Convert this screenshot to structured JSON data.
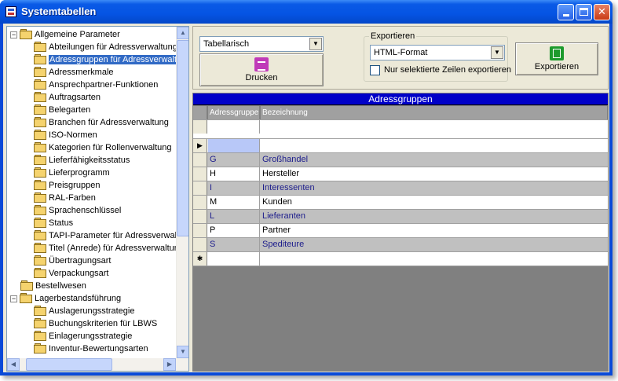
{
  "window": {
    "title": "Systemtabellen"
  },
  "tree": {
    "items": [
      {
        "label": "Allgemeine Parameter",
        "level": 0,
        "expander": "−"
      },
      {
        "label": "Abteilungen für Adressverwaltung",
        "level": 1
      },
      {
        "label": "Adressgruppen für Adressverwaltung",
        "level": 1,
        "selected": true
      },
      {
        "label": "Adressmerkmale",
        "level": 1
      },
      {
        "label": "Ansprechpartner-Funktionen",
        "level": 1
      },
      {
        "label": "Auftragsarten",
        "level": 1
      },
      {
        "label": "Belegarten",
        "level": 1
      },
      {
        "label": "Branchen für Adressverwaltung",
        "level": 1
      },
      {
        "label": "ISO-Normen",
        "level": 1
      },
      {
        "label": "Kategorien für Rollenverwaltung",
        "level": 1
      },
      {
        "label": "Lieferfähigkeitsstatus",
        "level": 1
      },
      {
        "label": "Lieferprogramm",
        "level": 1
      },
      {
        "label": "Preisgruppen",
        "level": 1
      },
      {
        "label": "RAL-Farben",
        "level": 1
      },
      {
        "label": "Sprachenschlüssel",
        "level": 1
      },
      {
        "label": "Status",
        "level": 1
      },
      {
        "label": "TAPI-Parameter für Adressverwaltung",
        "level": 1
      },
      {
        "label": "Titel (Anrede) für Adressverwaltung",
        "level": 1
      },
      {
        "label": "Übertragungsart",
        "level": 1
      },
      {
        "label": "Verpackungsart",
        "level": 1
      },
      {
        "label": "Bestellwesen",
        "level": 0
      },
      {
        "label": "Lagerbestandsführung",
        "level": 0,
        "expander": "−"
      },
      {
        "label": "Auslagerungsstrategie",
        "level": 1
      },
      {
        "label": "Buchungskriterien für LBWS",
        "level": 1
      },
      {
        "label": "Einlagerungsstrategie",
        "level": 1
      },
      {
        "label": "Inventur-Bewertungsarten",
        "level": 1
      }
    ]
  },
  "toolbar": {
    "view_select": "Tabellarisch",
    "print_label": "Drucken",
    "export_group_label": "Exportieren",
    "export_format": "HTML-Format",
    "only_selected_label": "Nur selektierte Zeilen exportieren",
    "export_label": "Exportieren"
  },
  "grid": {
    "caption": "Adressgruppen",
    "columns": [
      "Adressgruppe",
      "Bezeichnung"
    ],
    "rows": [
      {
        "code": "G",
        "name": "Großhandel"
      },
      {
        "code": "H",
        "name": "Hersteller"
      },
      {
        "code": "I",
        "name": "Interessenten"
      },
      {
        "code": "M",
        "name": "Kunden"
      },
      {
        "code": "L",
        "name": "Lieferanten"
      },
      {
        "code": "P",
        "name": "Partner"
      },
      {
        "code": "S",
        "name": "Spediteure"
      }
    ],
    "current_row_marker": "▶",
    "new_row_marker": "✱"
  },
  "colors": {
    "titlebar": "#0554e3",
    "grid_caption": "#0000c8",
    "selection": "#316ac5",
    "row_alt": "#c0c0c0"
  }
}
